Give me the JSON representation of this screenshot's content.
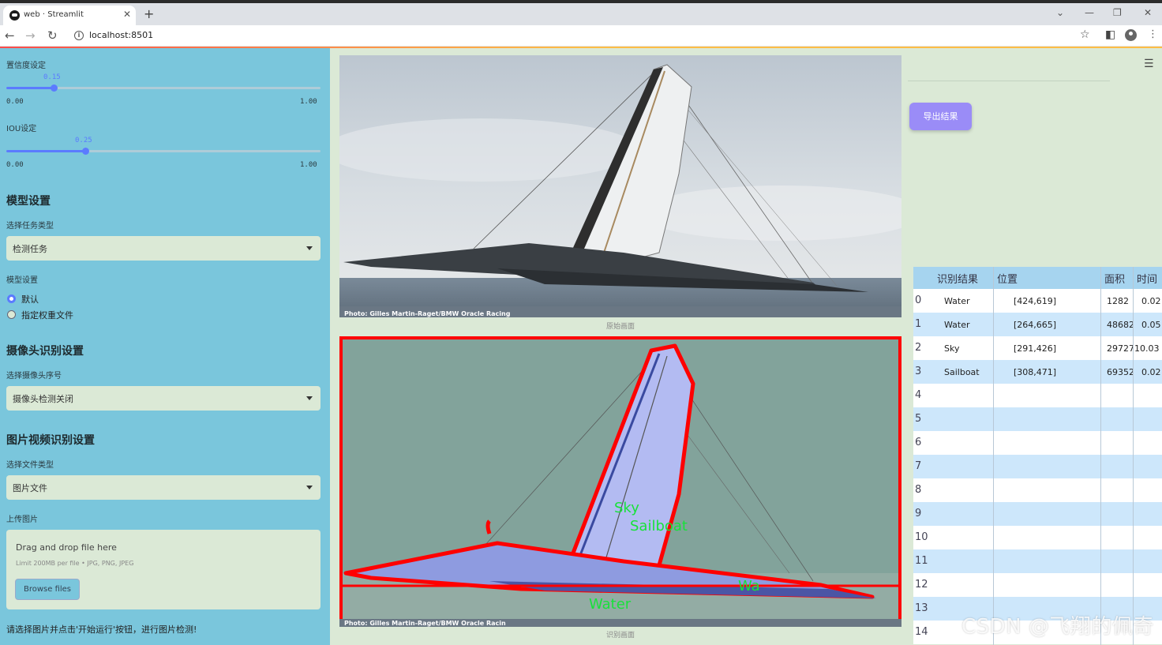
{
  "browser": {
    "tab_title": "web · Streamlit",
    "url": "localhost:8501"
  },
  "sidebar": {
    "conf_label": "置信度设定",
    "conf_value": "0.15",
    "conf_level": 0.15,
    "conf_min": "0.00",
    "conf_max": "1.00",
    "iou_label": "IOU设定",
    "iou_value": "0.25",
    "iou_level": 0.25,
    "iou_min": "0.00",
    "iou_max": "1.00",
    "model_header": "模型设置",
    "task_label": "选择任务类型",
    "task_value": "检测任务",
    "model_label": "模型设置",
    "model_opt_default": "默认",
    "model_opt_custom": "指定权重文件",
    "camera_header": "摄像头识别设置",
    "camera_label": "选择摄像头序号",
    "camera_value": "摄像头检测关闭",
    "media_header": "图片视频识别设置",
    "filetype_label": "选择文件类型",
    "filetype_value": "图片文件",
    "upload_label": "上传图片",
    "upload_main": "Drag and drop file here",
    "upload_sub": "Limit 200MB per file • JPG, PNG, JPEG",
    "browse_label": "Browse files",
    "status": "请选择图片并点击'开始运行'按钮，进行图片检测!"
  },
  "main": {
    "original_caption": "原始画面",
    "result_caption": "识别画面",
    "photo_credit": "Photo: Gilles Martin-Raget/BMW Oracle Racing",
    "photo_credit_result": "Photo: Gilles Martin-Raget/BMW Oracle Racin",
    "label_sky": "Sky",
    "label_sailboat": "Sailboat",
    "label_water_main": "Water",
    "label_water_small": "Wa",
    "export_label": "导出结果"
  },
  "table": {
    "headers": [
      "识别结果",
      "位置",
      "面积",
      "时间"
    ],
    "rows": [
      {
        "idx": "0",
        "cls": "Water",
        "pos": "[424,619]",
        "area": "1282",
        "time": "0.02"
      },
      {
        "idx": "1",
        "cls": "Water",
        "pos": "[264,665]",
        "area": "48682",
        "time": "0.05"
      },
      {
        "idx": "2",
        "cls": "Sky",
        "pos": "[291,426]",
        "area": "2972710.03",
        "time": ""
      },
      {
        "idx": "3",
        "cls": "Sailboat",
        "pos": "[308,471]",
        "area": "69352",
        "time": "0.02"
      },
      {
        "idx": "4",
        "cls": "",
        "pos": "",
        "area": "",
        "time": ""
      },
      {
        "idx": "5",
        "cls": "",
        "pos": "",
        "area": "",
        "time": ""
      },
      {
        "idx": "6",
        "cls": "",
        "pos": "",
        "area": "",
        "time": ""
      },
      {
        "idx": "7",
        "cls": "",
        "pos": "",
        "area": "",
        "time": ""
      },
      {
        "idx": "8",
        "cls": "",
        "pos": "",
        "area": "",
        "time": ""
      },
      {
        "idx": "9",
        "cls": "",
        "pos": "",
        "area": "",
        "time": ""
      },
      {
        "idx": "10",
        "cls": "",
        "pos": "",
        "area": "",
        "time": ""
      },
      {
        "idx": "11",
        "cls": "",
        "pos": "",
        "area": "",
        "time": ""
      },
      {
        "idx": "12",
        "cls": "",
        "pos": "",
        "area": "",
        "time": ""
      },
      {
        "idx": "13",
        "cls": "",
        "pos": "",
        "area": "",
        "time": ""
      },
      {
        "idx": "14",
        "cls": "",
        "pos": "",
        "area": "",
        "time": ""
      }
    ]
  },
  "watermark": "CSDN @飞翔的佩奇",
  "colors": {
    "sidebar": "#7ac6dc",
    "main_bg": "#dbe9d6",
    "accent": "#5b7bff",
    "export_button": "#9a8cf7",
    "detect_border": "#ff0000",
    "label_green": "#18e23a"
  }
}
